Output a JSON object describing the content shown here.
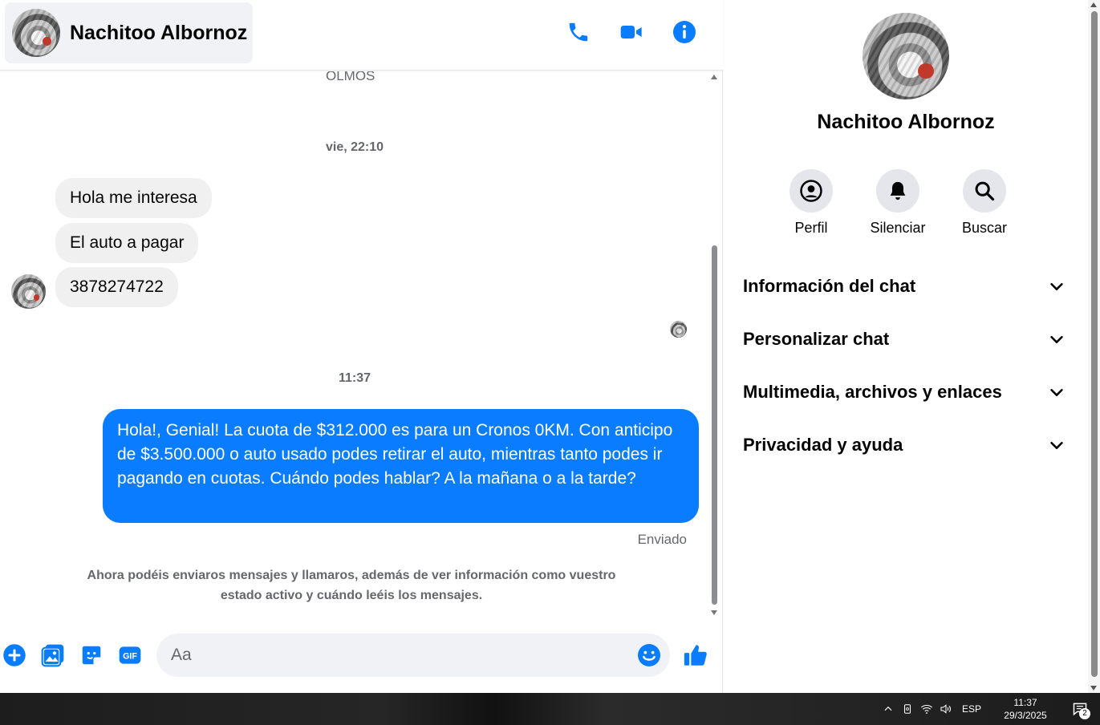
{
  "header": {
    "contact_name": "Nachitoo Albornoz",
    "actions": [
      {
        "name": "phone-icon",
        "label": "Llamar"
      },
      {
        "name": "video-camera-icon",
        "label": "Videollamada"
      },
      {
        "name": "info-icon",
        "label": "Información"
      }
    ]
  },
  "messages": {
    "previous_snippet": "OLMOS",
    "timestamp_1": "vie, 22:10",
    "incoming": [
      "Hola me interesa",
      "El auto a pagar",
      "3878274722"
    ],
    "timestamp_2": "11:37",
    "outgoing": "Hola!, Genial! La cuota de $312.000 es para un Cronos 0KM. Con anticipo de $3.500.000 o auto usado podes retirar el auto, mientras tanto podes ir pagando en cuotas. Cuándo podes hablar? A la mañana o a la tarde?",
    "sent_status": "Enviado",
    "notice": "Ahora podéis enviaros mensajes y llamaros, además de ver información como vuestro estado activo y cuándo leéis los mensajes."
  },
  "composer": {
    "placeholder": "Aa",
    "buttons": [
      "plus-icon",
      "image-icon",
      "sticker-icon",
      "gif-icon"
    ],
    "gif_label": "GIF",
    "emoji_icon": "smiley-icon",
    "like_icon": "thumbs-up-icon"
  },
  "panel": {
    "name": "Nachitoo Albornoz",
    "actions": [
      {
        "icon": "profile-icon",
        "label": "Perfil"
      },
      {
        "icon": "bell-icon",
        "label": "Silenciar"
      },
      {
        "icon": "search-icon",
        "label": "Buscar"
      }
    ],
    "sections": [
      "Información del chat",
      "Personalizar chat",
      "Multimedia, archivos y enlaces",
      "Privacidad y ayuda"
    ]
  },
  "taskbar": {
    "language": "ESP",
    "time": "11:37",
    "date": "29/3/2025",
    "notification_count": "2"
  },
  "colors": {
    "accent": "#0a7cff",
    "incoming_bubble": "#f0f0f0",
    "secondary_text": "#65676b"
  }
}
